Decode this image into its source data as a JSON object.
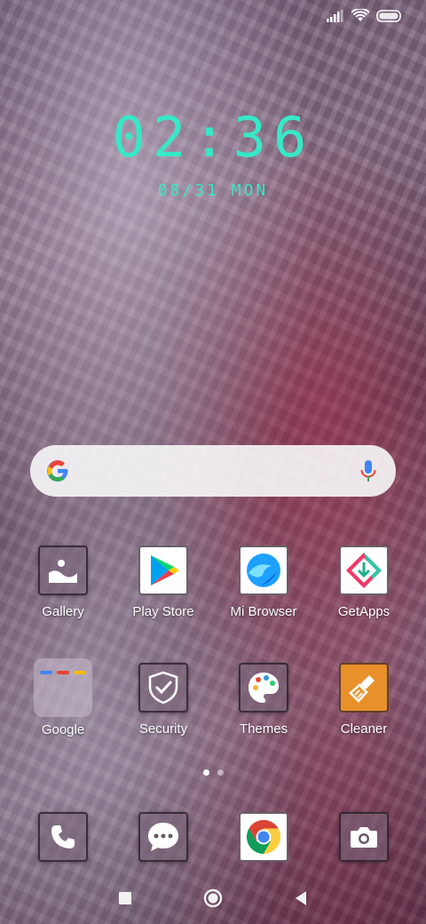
{
  "clock": {
    "time": "02:36",
    "date": "08/31 MON"
  },
  "search": {
    "logo_text": "G",
    "icons": [
      "google-logo-icon",
      "microphone-icon"
    ]
  },
  "apps_row1": [
    {
      "label": "Gallery",
      "icon": "gallery-icon"
    },
    {
      "label": "Play Store",
      "icon": "play-store-icon"
    },
    {
      "label": "Mi Browser",
      "icon": "mi-browser-icon"
    },
    {
      "label": "GetApps",
      "icon": "getapps-icon"
    }
  ],
  "apps_row2": [
    {
      "label": "Google",
      "icon": "google-folder-icon"
    },
    {
      "label": "Security",
      "icon": "security-icon"
    },
    {
      "label": "Themes",
      "icon": "themes-icon"
    },
    {
      "label": "Cleaner",
      "icon": "cleaner-icon"
    }
  ],
  "dock": [
    {
      "icon": "phone-icon"
    },
    {
      "icon": "messages-icon"
    },
    {
      "icon": "chrome-icon"
    },
    {
      "icon": "camera-icon"
    }
  ],
  "page_indicator": {
    "pages": 2,
    "active": 1
  },
  "nav": [
    "recents-button",
    "home-button",
    "back-button"
  ],
  "colors": {
    "clock": "#37e8c7",
    "search_bg": "#f5f4f6",
    "cleaner": "#e8912b"
  }
}
